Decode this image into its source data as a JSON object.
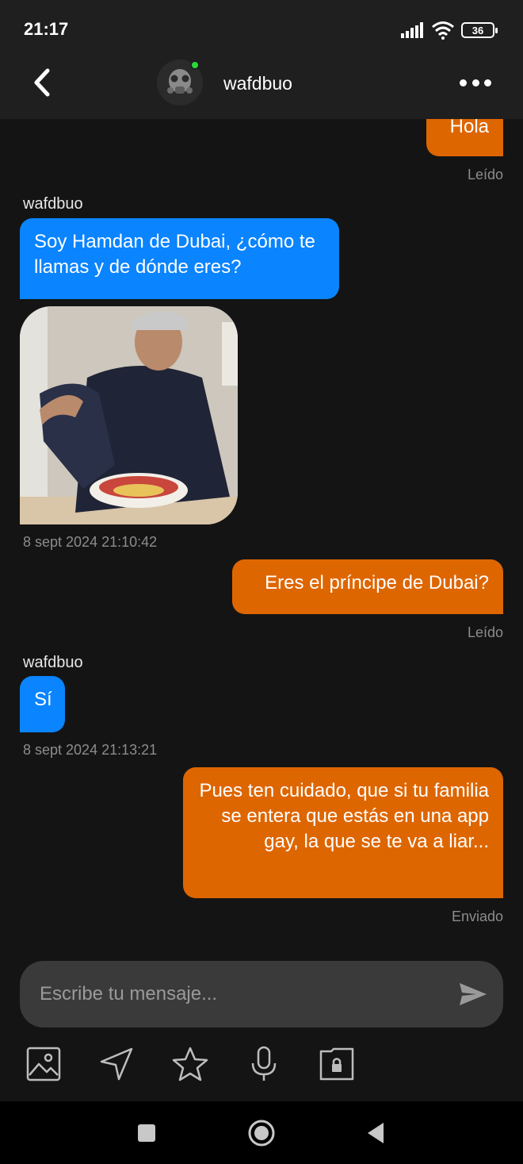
{
  "status_bar": {
    "time": "21:17",
    "battery": "36"
  },
  "header": {
    "contact_name": "wafdbuo"
  },
  "messages": {
    "m0": {
      "text": "Hola",
      "status": "Leído"
    },
    "m1": {
      "sender": "wafdbuo",
      "text": "Soy Hamdan de Dubai, ¿cómo te llamas y de dónde eres?",
      "timestamp": "8 sept 2024 21:10:42"
    },
    "m2": {
      "text": "Eres el príncipe de Dubai?",
      "status": "Leído"
    },
    "m3": {
      "sender": "wafdbuo",
      "text": "Sí",
      "timestamp": "8 sept 2024 21:13:21"
    },
    "m4": {
      "text": "Pues ten cuidado, que si tu familia se entera que estás en una app gay, la que se te va a liar...",
      "status": "Enviado"
    }
  },
  "composer": {
    "placeholder": "Escribe tu mensaje..."
  },
  "toolbar": {
    "icons": [
      "image-icon",
      "location-icon",
      "star-icon",
      "microphone-icon",
      "private-album-icon"
    ]
  },
  "colors": {
    "outgoing_bubble": "#de6600",
    "incoming_bubble": "#0a84ff",
    "online": "#29d93a"
  }
}
